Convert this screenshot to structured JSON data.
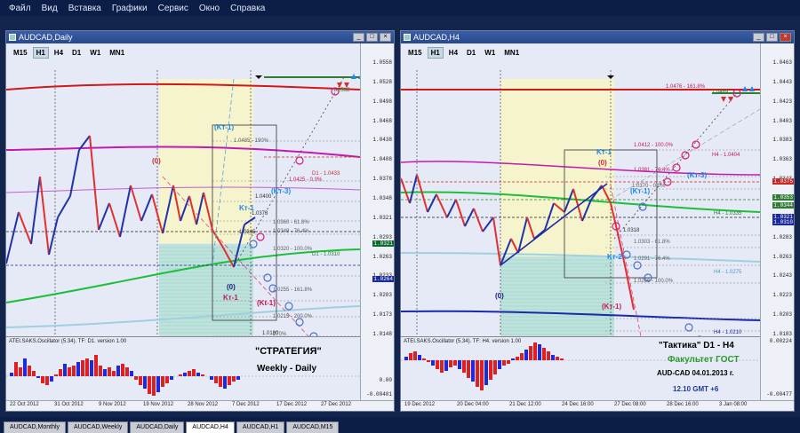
{
  "menu": [
    "Файл",
    "Вид",
    "Вставка",
    "Графики",
    "Сервис",
    "Окно",
    "Справка"
  ],
  "timeframes": [
    "M15",
    "H1",
    "H4",
    "D1",
    "W1",
    "MN1"
  ],
  "left": {
    "title": "AUDCAD,Daily",
    "active_tf": "D1",
    "price_ticks": [
      "1.0558",
      "1.0528",
      "1.0498",
      "1.0468",
      "1.0438",
      "1.0408",
      "1.0378",
      "1.0348",
      "1.0321",
      "1.0293",
      "1.0263",
      "1.0233",
      "1.0203",
      "1.0173",
      "1.0148"
    ],
    "price_labels": [
      {
        "text": "1.0321",
        "color": "#0c6b2a"
      },
      {
        "text": "1.0264",
        "color": "#1a2a9a"
      }
    ],
    "levels": [
      {
        "text": "1.0485 - 190%",
        "color": "#606060"
      },
      {
        "text": "1.0425 - 0.0%",
        "color": "#c2185b"
      },
      {
        "text": "D1 - 1.0433",
        "color": "#c0392b"
      },
      {
        "text": "1.0400",
        "color": "#303030"
      },
      {
        "text": "1.0373",
        "color": "#303030"
      },
      {
        "text": "1.0360 - 61.8%",
        "color": "#606060"
      },
      {
        "text": "1.0345",
        "color": "#303030"
      },
      {
        "text": "1.0349 - 76.4%",
        "color": "#606060"
      },
      {
        "text": "1.0320 - 100.0%",
        "color": "#606060"
      },
      {
        "text": "D1 - 1.0310",
        "color": "#2e7d32"
      },
      {
        "text": "1.0255 - 161.8%",
        "color": "#606060"
      },
      {
        "text": "1.0215 - 200.0%",
        "color": "#606060"
      },
      {
        "text": "1.0180",
        "color": "#303030"
      },
      {
        "text": "270%",
        "color": "#606060"
      },
      {
        "text": "1.0155 - 261.8%",
        "color": "#606060"
      },
      {
        "text": "D1 - 1.0180",
        "color": "#4aa0c0"
      },
      {
        "text": "1.0562",
        "color": "#2e7d32"
      }
    ],
    "wave_labels": [
      {
        "text": "(0)",
        "color": "#d32f2f"
      },
      {
        "text": "(Kт-1)",
        "color": "#1e88e5"
      },
      {
        "text": "(Kт-3)",
        "color": "#1e88e5"
      },
      {
        "text": "Kт-1",
        "color": "#1e88e5"
      },
      {
        "text": "(0)",
        "color": "#1a237e"
      },
      {
        "text": "Kт-1",
        "color": "#c2185b"
      },
      {
        "text": "(Kt-1)",
        "color": "#c2185b"
      }
    ],
    "osc_title": "ATEI.SAKS.Oscillator (5.34). TF: D1. version 1.00",
    "osc_ticks": [
      "0.00",
      "-0.00401"
    ],
    "overlay": [
      "\"СТРАТЕГИЯ\"",
      "Weekly - Daily"
    ],
    "x_labels": [
      "22 Oct 2012",
      "31 Oct 2012",
      "9 Nov 2012",
      "19 Nov 2012",
      "28 Nov 2012",
      "7 Dec 2012",
      "17 Dec 2012",
      "27 Dec 2012"
    ]
  },
  "right": {
    "title": "AUDCAD,H4",
    "active_tf": "H4",
    "price_ticks": [
      "1.0463",
      "1.0443",
      "1.0423",
      "1.0403",
      "1.0383",
      "1.0363",
      "1.0343",
      "1.0323",
      "1.0303",
      "1.0283",
      "1.0263",
      "1.0243",
      "1.0223",
      "1.0203",
      "1.0183"
    ],
    "price_labels": [
      {
        "text": "1.0375",
        "color": "#c62828"
      },
      {
        "text": "1.0353",
        "color": "#2e7d32"
      },
      {
        "text": "1.0344",
        "color": "#2e7d32"
      },
      {
        "text": "1.0321",
        "color": "#1a2a9a"
      },
      {
        "text": "1.0310",
        "color": "#1a2a9a"
      }
    ],
    "levels": [
      {
        "text": "1.0476 - 161.8%",
        "color": "#c2185b"
      },
      {
        "text": "1.0469",
        "color": "#2e7d32"
      },
      {
        "text": "1.0412 - 100.0%",
        "color": "#c2185b"
      },
      {
        "text": "H4 - 1.0404",
        "color": "#c2185b"
      },
      {
        "text": "1.0381 - 76.4%",
        "color": "#c2185b"
      },
      {
        "text": "1.0370 - 0.0%",
        "color": "#606060"
      },
      {
        "text": "H4 - 1.0335",
        "color": "#2e7d32"
      },
      {
        "text": "1.0318",
        "color": "#303030"
      },
      {
        "text": "1.0303 - 61.8%",
        "color": "#606060"
      },
      {
        "text": "1.0291 - 76.4%",
        "color": "#606060"
      },
      {
        "text": "H4 - 1.0275",
        "color": "#4aa0c0"
      },
      {
        "text": "1.0266 - 100.0%",
        "color": "#606060"
      },
      {
        "text": "H4 - 1.0210",
        "color": "#1a2a9a"
      },
      {
        "text": "1.0203 - 61.8%",
        "color": "#606060"
      }
    ],
    "wave_labels": [
      {
        "text": "Kт-1",
        "color": "#1e88e5"
      },
      {
        "text": "(0)",
        "color": "#d32f2f"
      },
      {
        "text": "(Kт-1)",
        "color": "#1e88e5"
      },
      {
        "text": "(Kт-3)",
        "color": "#1e88e5"
      },
      {
        "text": "Kт-2",
        "color": "#1e88e5"
      },
      {
        "text": "(0)",
        "color": "#1a237e"
      },
      {
        "text": "(Kт-1)",
        "color": "#c2185b"
      }
    ],
    "osc_title": "ATEI.SAKS.Oscillator (5.34). TF: H4. version 1.00",
    "osc_ticks": [
      "0.00224",
      "-0.00477"
    ],
    "overlay": [
      "\"Тактика\"  D1 - H4",
      "Факультет ГОСТ",
      "AUD-CAD  04.01.2013  г.",
      "12.10    GMT +6"
    ],
    "x_labels": [
      "19 Dec 2012",
      "20 Dec 04:00",
      "21 Dec 12:00",
      "24 Dec 16:00",
      "27 Dec 08:00",
      "28 Dec 16:00",
      "3 Jan 08:00"
    ]
  },
  "tabs": [
    "AUDCAD,Monthly",
    "AUDCAD,Weekly",
    "AUDCAD,Daily",
    "AUDCAD,H4",
    "AUDCAD,H1",
    "AUDCAD,M15"
  ],
  "active_tab": "AUDCAD,H4",
  "colors": {
    "bull": "#2233aa",
    "bear": "#e03030",
    "zone_yellow": "#f6f4cc",
    "zone_teal": "#bfe3dc"
  }
}
